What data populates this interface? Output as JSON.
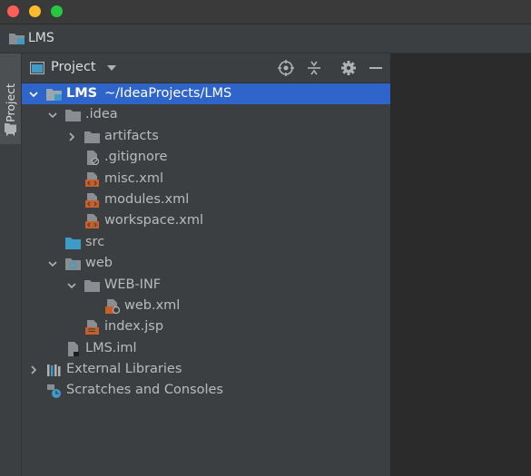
{
  "window": {
    "traffic_lights": {
      "close": "#fe5f57",
      "minimize": "#febb2e",
      "maximize": "#27c840"
    }
  },
  "navbar": {
    "label": "LMS",
    "icon": "project-folder-icon"
  },
  "sidebar_strip": {
    "tab_label": "1: Project",
    "icon": "folder-icon"
  },
  "panel": {
    "title": "Project",
    "toolbar": [
      "locate-icon",
      "collapse-all-icon",
      "settings-gear-icon",
      "hide-minus-icon"
    ]
  },
  "tree": {
    "root": {
      "name": "LMS",
      "path": "~/IdeaProjects/LMS"
    },
    "idea_folder": ".idea",
    "artifacts": "artifacts",
    "gitignore": ".gitignore",
    "misc": "misc.xml",
    "modules": "modules.xml",
    "workspace": "workspace.xml",
    "src": "src",
    "web": "web",
    "webinf": "WEB-INF",
    "webxml": "web.xml",
    "indexjsp": "index.jsp",
    "iml": "LMS.iml",
    "external": "External Libraries",
    "scratches": "Scratches and Consoles"
  },
  "colors": {
    "selection": "#2f65ca",
    "panel_bg": "#3c3f41",
    "editor_bg": "#2b2b2b",
    "xml_icon": "#c75f2a",
    "folder_icon": "#8a8e92",
    "source_folder": "#3e9bc8"
  }
}
